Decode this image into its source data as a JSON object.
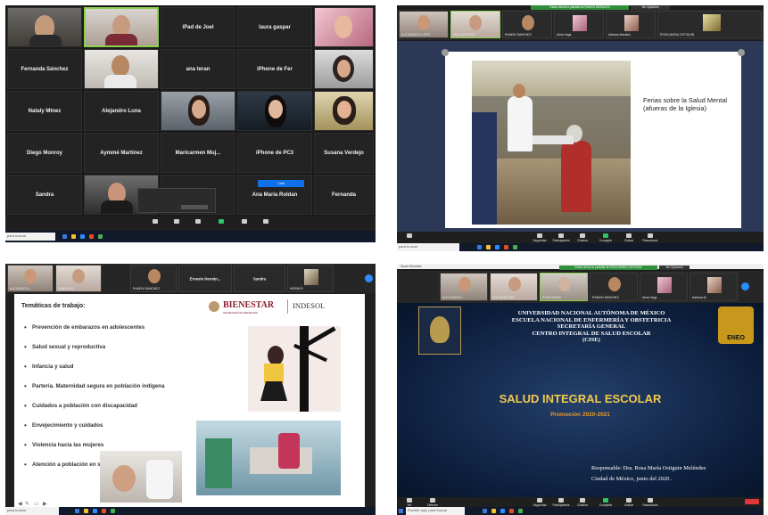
{
  "panel1": {
    "row1_names": [
      "iPad de Joel",
      "laura gaspar"
    ],
    "row2_names": [
      "Fernanda Sánchez",
      "ana teran",
      "iPhone de Fer"
    ],
    "row3_names": [
      "Nataly Mtnez",
      "Alejandro Luna"
    ],
    "row4_names": [
      "Diego Monroy",
      "Aymmé Martínez",
      "Maricarmen  Muj...",
      "iPhone de PC3",
      "Susana Verdejo"
    ],
    "row5_names": [
      "Sandra",
      "Ana Maria Roldan",
      "Fernanda"
    ],
    "popup_text": "Chat",
    "taskbar_search": "para buscar"
  },
  "panel2": {
    "banner_green": "Estás viendo la pantalla de RAMOS MORALES",
    "banner_dark": "Ver Opciones",
    "strip_names": [
      "ALEJANDRO LOPEZ",
      "ANA MARTINEZ",
      "RAMON SANCHEZ",
      "Alma Vega",
      "Adriana Morales",
      "ROSA MARIA OSTIGUIN"
    ],
    "slide_text": "Ferias sobre la Salud Mental (afueras de la Iglesia)",
    "taskbar_search": "para buscar",
    "toolbar": [
      "Seguridad",
      "Participantes",
      "Chatear",
      "Compartir pantalla",
      "Grabar",
      "Reacciones"
    ]
  },
  "panel3": {
    "strip_names": [
      "ALEJANDRO L.",
      "GABRIELA",
      "RAMON SANCHEZ",
      "Ernesto  Hernán...",
      "Sandra",
      "NOEMI R."
    ],
    "slide_title": "Temáticas de trabajo:",
    "bullets": [
      "Prevención de embarazos en adolescentes",
      "Salud sexual y reproductiva",
      "Infancia y salud",
      " Partería. Maternidad segura en población indígena",
      "Cuidados  a población con discapacidad",
      "Envejecimiento y cuidados",
      "Violencia hacia las mujeres",
      "Atención a población en situación vulnerable"
    ],
    "logo_bienestar": "BIENESTAR",
    "logo_bienestar_sub": "SECRETARÍA DE BIENESTAR",
    "logo_indesol": "INDESOL",
    "taskbar_search": "para buscar"
  },
  "panel4": {
    "window_title": "Zoom Reunión",
    "banner_green": "Estás viendo la pantalla de ROSA MARIA OSTIGUIN",
    "banner_dark": "Ver Opciones",
    "strip_names": [
      "ALEJANDRO L.",
      "ANA MARTINEZ",
      "ROSA MARIA",
      "RAMON SANCHEZ",
      "Alma Vega",
      "Adriana M."
    ],
    "header_lines": [
      "UNIVERSIDAD NACIONAL AUTÓNOMA DE MÉXICO",
      "ESCUELA NACIONAL DE ENFERMERÍA Y OBSTETRICIA",
      "SECRETARÍA GENERAL",
      "CENTRO INTEGRAL DE SALUD ESCOLAR",
      "(CISE)"
    ],
    "title": "SALUD INTEGRAL ESCOLAR",
    "promo": "Promoción 2020-2021",
    "responsable": "Responsable: Dra.  Rosa María Ostiguin Meléndez",
    "ciudad": "Ciudad de México, junio del 2020 .",
    "eneo_logo": "ENEO",
    "toolbar": [
      "Ver Participantes",
      "Detener video",
      "Seguridad",
      "Participantes",
      "Chatear",
      "Compartir pantalla",
      "Grabar",
      "Reacciones"
    ],
    "taskbar_search": "Escribe aquí para buscar"
  }
}
